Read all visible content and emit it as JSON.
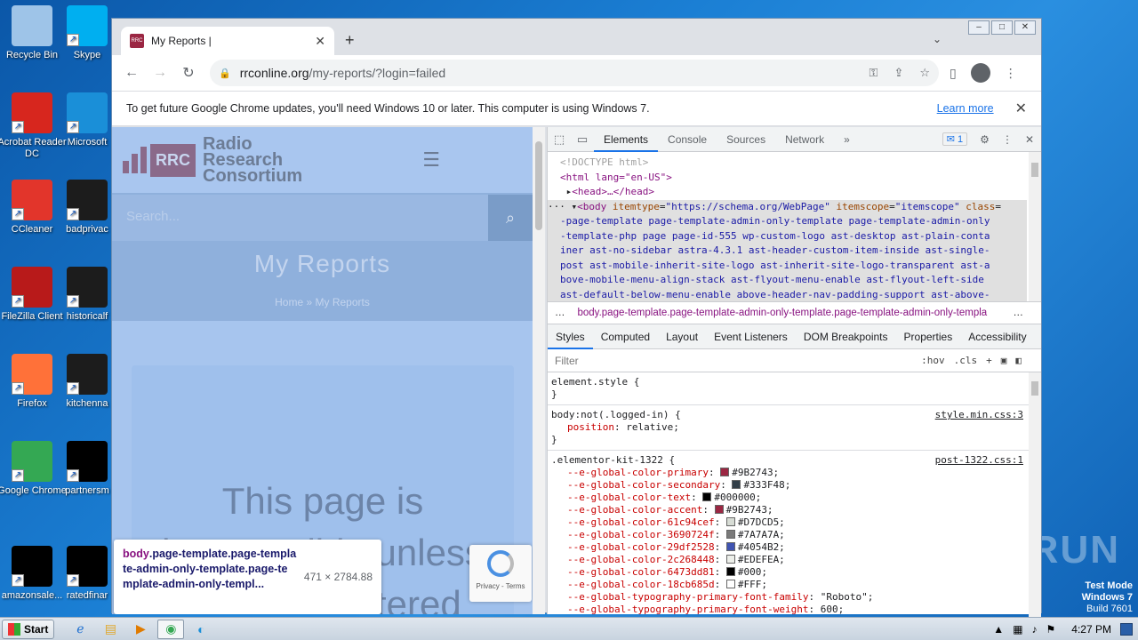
{
  "desktop": {
    "icons": [
      {
        "label": "Recycle Bin",
        "icon": "recycle-bin-icon",
        "color": "#9ec4e8"
      },
      {
        "label": "Skype",
        "icon": "skype-icon",
        "color": "#00aff0"
      },
      {
        "label": "Acrobat Reader DC",
        "icon": "acrobat-icon",
        "color": "#d7261e"
      },
      {
        "label": "Microsoft",
        "icon": "edge-icon",
        "color": "#1a8fd8"
      },
      {
        "label": "CCleaner",
        "icon": "ccleaner-icon",
        "color": "#e2352b"
      },
      {
        "label": "badprivac",
        "icon": "file-icon",
        "color": "#1c1c1c"
      },
      {
        "label": "FileZilla Client",
        "icon": "filezilla-icon",
        "color": "#b81a1a"
      },
      {
        "label": "historicalf",
        "icon": "file-icon",
        "color": "#1c1c1c"
      },
      {
        "label": "Firefox",
        "icon": "firefox-icon",
        "color": "#ff7139"
      },
      {
        "label": "kitchenna",
        "icon": "file-icon",
        "color": "#1c1c1c"
      },
      {
        "label": "Google Chrome",
        "icon": "chrome-icon",
        "color": "#34a853"
      },
      {
        "label": "partnersm",
        "icon": "file-icon",
        "color": "#000000"
      },
      {
        "label": "amazonsale...",
        "icon": "file-icon",
        "color": "#000000"
      },
      {
        "label": "ratedfinar",
        "icon": "file-icon",
        "color": "#000000"
      }
    ],
    "watermark": "ANY RUN",
    "test_mode": {
      "line1": "Test Mode",
      "line2": "Windows 7",
      "line3": "Build 7601"
    }
  },
  "browser": {
    "tab_title": "My Reports |",
    "url_domain": "rrconline.org",
    "url_path": "/my-reports/?login=failed",
    "infobar_text": "To get future Google Chrome updates, you'll need Windows 10 or later. This computer is using Windows 7.",
    "infobar_link": "Learn more"
  },
  "page": {
    "logo_abbr": "RRC",
    "logo_line1": "Radio",
    "logo_line2": "Research",
    "logo_line3": "Consortium",
    "search_placeholder": "Search...",
    "title": "My Reports",
    "breadcrumb": "Home » My Reports",
    "big_text": "This page is inaccessible unless you're registered",
    "tooltip_tag": "body",
    "tooltip_selector": ".page-template.page-template-admin-only-template.page-template-admin-only-templ...",
    "tooltip_size": "471 × 2784.88",
    "recaptcha_text": "Privacy - Terms"
  },
  "devtools": {
    "tabs": [
      "Elements",
      "Console",
      "Sources",
      "Network"
    ],
    "issues_count": "1",
    "dom": {
      "doctype": "<!DOCTYPE html>",
      "html_open": "<html lang=\"en-US\">",
      "head": "<head>…</head>",
      "body_lines": [
        "-page-template page-template-admin-only-template page-template-admin-only",
        "-template-php page page-id-555 wp-custom-logo ast-desktop ast-plain-conta",
        "iner ast-no-sidebar astra-4.3.1 ast-header-custom-item-inside ast-single-",
        "post ast-mobile-inherit-site-logo ast-inherit-site-logo-transparent ast-a",
        "bove-mobile-menu-align-stack ast-flyout-menu-enable ast-flyout-left-side",
        "ast-default-below-menu-enable above-header-nav-padding-support ast-above-"
      ]
    },
    "breadcrumb": "body.page-template.page-template-admin-only-template.page-template-admin-only-templa",
    "subtabs": [
      "Styles",
      "Computed",
      "Layout",
      "Event Listeners",
      "DOM Breakpoints",
      "Properties",
      "Accessibility"
    ],
    "filter_placeholder": "Filter",
    "filter_hov": ":hov",
    "filter_cls": ".cls",
    "rule1_selector": "element.style {",
    "rule2": {
      "selector": "body:not(.logged-in) {",
      "source": "style.min.css:3",
      "prop": "position",
      "value": "relative;"
    },
    "rule3_selector": ".elementor-kit-1322 {",
    "rule3_source": "post-1322.css:1",
    "vars": [
      {
        "name": "--e-global-color-primary",
        "value": "#9B2743;",
        "color": "#9B2743"
      },
      {
        "name": "--e-global-color-secondary",
        "value": "#333F48;",
        "color": "#333F48"
      },
      {
        "name": "--e-global-color-text",
        "value": "#000000;",
        "color": "#000000"
      },
      {
        "name": "--e-global-color-accent",
        "value": "#9B2743;",
        "color": "#9B2743"
      },
      {
        "name": "--e-global-color-61c94cef",
        "value": "#D7DCD5;",
        "color": "#D7DCD5"
      },
      {
        "name": "--e-global-color-3690724f",
        "value": "#7A7A7A;",
        "color": "#7A7A7A"
      },
      {
        "name": "--e-global-color-29df2528",
        "value": "#4054B2;",
        "color": "#4054B2"
      },
      {
        "name": "--e-global-color-2c268448",
        "value": "#EDEFEA;",
        "color": "#EDEFEA"
      },
      {
        "name": "--e-global-color-6473dd81",
        "value": "#000;",
        "color": "#000000"
      },
      {
        "name": "--e-global-color-18cb685d",
        "value": "#FFF;",
        "color": "#FFFFFF"
      },
      {
        "name": "--e-global-typography-primary-font-family",
        "value": "\"Roboto\";",
        "color": ""
      },
      {
        "name": "--e-global-typography-primary-font-weight",
        "value": "600;",
        "color": ""
      }
    ]
  },
  "taskbar": {
    "start_label": "Start",
    "clock": "4:27 PM"
  }
}
